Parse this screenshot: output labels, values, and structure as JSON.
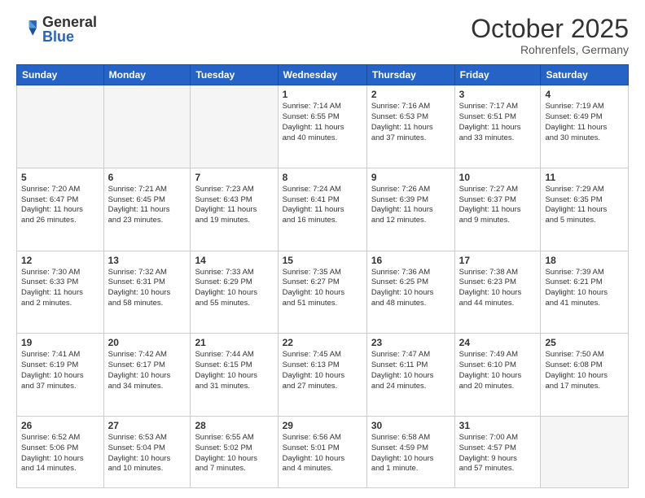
{
  "logo": {
    "general": "General",
    "blue": "Blue"
  },
  "title": "October 2025",
  "location": "Rohrenfels, Germany",
  "headers": [
    "Sunday",
    "Monday",
    "Tuesday",
    "Wednesday",
    "Thursday",
    "Friday",
    "Saturday"
  ],
  "weeks": [
    [
      {
        "day": "",
        "info": ""
      },
      {
        "day": "",
        "info": ""
      },
      {
        "day": "",
        "info": ""
      },
      {
        "day": "1",
        "info": "Sunrise: 7:14 AM\nSunset: 6:55 PM\nDaylight: 11 hours\nand 40 minutes."
      },
      {
        "day": "2",
        "info": "Sunrise: 7:16 AM\nSunset: 6:53 PM\nDaylight: 11 hours\nand 37 minutes."
      },
      {
        "day": "3",
        "info": "Sunrise: 7:17 AM\nSunset: 6:51 PM\nDaylight: 11 hours\nand 33 minutes."
      },
      {
        "day": "4",
        "info": "Sunrise: 7:19 AM\nSunset: 6:49 PM\nDaylight: 11 hours\nand 30 minutes."
      }
    ],
    [
      {
        "day": "5",
        "info": "Sunrise: 7:20 AM\nSunset: 6:47 PM\nDaylight: 11 hours\nand 26 minutes."
      },
      {
        "day": "6",
        "info": "Sunrise: 7:21 AM\nSunset: 6:45 PM\nDaylight: 11 hours\nand 23 minutes."
      },
      {
        "day": "7",
        "info": "Sunrise: 7:23 AM\nSunset: 6:43 PM\nDaylight: 11 hours\nand 19 minutes."
      },
      {
        "day": "8",
        "info": "Sunrise: 7:24 AM\nSunset: 6:41 PM\nDaylight: 11 hours\nand 16 minutes."
      },
      {
        "day": "9",
        "info": "Sunrise: 7:26 AM\nSunset: 6:39 PM\nDaylight: 11 hours\nand 12 minutes."
      },
      {
        "day": "10",
        "info": "Sunrise: 7:27 AM\nSunset: 6:37 PM\nDaylight: 11 hours\nand 9 minutes."
      },
      {
        "day": "11",
        "info": "Sunrise: 7:29 AM\nSunset: 6:35 PM\nDaylight: 11 hours\nand 5 minutes."
      }
    ],
    [
      {
        "day": "12",
        "info": "Sunrise: 7:30 AM\nSunset: 6:33 PM\nDaylight: 11 hours\nand 2 minutes."
      },
      {
        "day": "13",
        "info": "Sunrise: 7:32 AM\nSunset: 6:31 PM\nDaylight: 10 hours\nand 58 minutes."
      },
      {
        "day": "14",
        "info": "Sunrise: 7:33 AM\nSunset: 6:29 PM\nDaylight: 10 hours\nand 55 minutes."
      },
      {
        "day": "15",
        "info": "Sunrise: 7:35 AM\nSunset: 6:27 PM\nDaylight: 10 hours\nand 51 minutes."
      },
      {
        "day": "16",
        "info": "Sunrise: 7:36 AM\nSunset: 6:25 PM\nDaylight: 10 hours\nand 48 minutes."
      },
      {
        "day": "17",
        "info": "Sunrise: 7:38 AM\nSunset: 6:23 PM\nDaylight: 10 hours\nand 44 minutes."
      },
      {
        "day": "18",
        "info": "Sunrise: 7:39 AM\nSunset: 6:21 PM\nDaylight: 10 hours\nand 41 minutes."
      }
    ],
    [
      {
        "day": "19",
        "info": "Sunrise: 7:41 AM\nSunset: 6:19 PM\nDaylight: 10 hours\nand 37 minutes."
      },
      {
        "day": "20",
        "info": "Sunrise: 7:42 AM\nSunset: 6:17 PM\nDaylight: 10 hours\nand 34 minutes."
      },
      {
        "day": "21",
        "info": "Sunrise: 7:44 AM\nSunset: 6:15 PM\nDaylight: 10 hours\nand 31 minutes."
      },
      {
        "day": "22",
        "info": "Sunrise: 7:45 AM\nSunset: 6:13 PM\nDaylight: 10 hours\nand 27 minutes."
      },
      {
        "day": "23",
        "info": "Sunrise: 7:47 AM\nSunset: 6:11 PM\nDaylight: 10 hours\nand 24 minutes."
      },
      {
        "day": "24",
        "info": "Sunrise: 7:49 AM\nSunset: 6:10 PM\nDaylight: 10 hours\nand 20 minutes."
      },
      {
        "day": "25",
        "info": "Sunrise: 7:50 AM\nSunset: 6:08 PM\nDaylight: 10 hours\nand 17 minutes."
      }
    ],
    [
      {
        "day": "26",
        "info": "Sunrise: 6:52 AM\nSunset: 5:06 PM\nDaylight: 10 hours\nand 14 minutes."
      },
      {
        "day": "27",
        "info": "Sunrise: 6:53 AM\nSunset: 5:04 PM\nDaylight: 10 hours\nand 10 minutes."
      },
      {
        "day": "28",
        "info": "Sunrise: 6:55 AM\nSunset: 5:02 PM\nDaylight: 10 hours\nand 7 minutes."
      },
      {
        "day": "29",
        "info": "Sunrise: 6:56 AM\nSunset: 5:01 PM\nDaylight: 10 hours\nand 4 minutes."
      },
      {
        "day": "30",
        "info": "Sunrise: 6:58 AM\nSunset: 4:59 PM\nDaylight: 10 hours\nand 1 minute."
      },
      {
        "day": "31",
        "info": "Sunrise: 7:00 AM\nSunset: 4:57 PM\nDaylight: 9 hours\nand 57 minutes."
      },
      {
        "day": "",
        "info": ""
      }
    ]
  ]
}
